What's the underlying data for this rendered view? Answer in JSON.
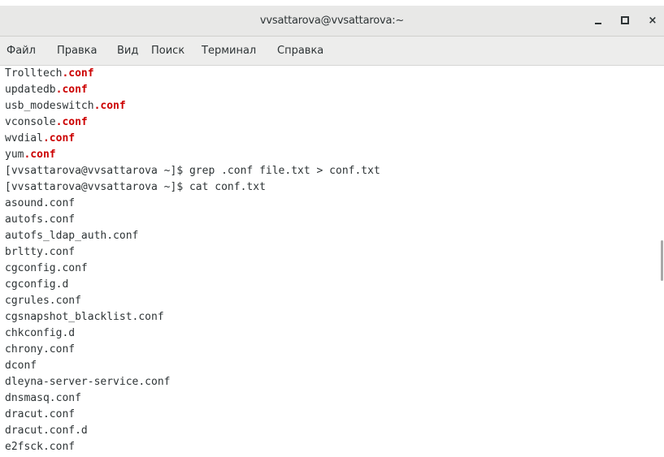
{
  "window": {
    "title": "vvsattarova@vvsattarova:~",
    "minimize_icon": "minimize-icon",
    "maximize_icon": "maximize-icon",
    "close_icon": "close-icon",
    "close_glyph": "×"
  },
  "menu": {
    "items": [
      "Файл",
      "Правка",
      "Вид",
      "Поиск",
      "Терминал",
      "Справка"
    ]
  },
  "terminal": {
    "lines": [
      {
        "pre": "Trolltech",
        "hl": ".conf"
      },
      {
        "pre": "updatedb",
        "hl": ".conf"
      },
      {
        "pre": "usb_modeswitch",
        "hl": ".conf"
      },
      {
        "pre": "vconsole",
        "hl": ".conf"
      },
      {
        "pre": "wvdial",
        "hl": ".conf"
      },
      {
        "pre": "yum",
        "hl": ".conf"
      },
      {
        "pre": "[vvsattarova@vvsattarova ~]$ grep .conf file.txt > conf.txt",
        "hl": ""
      },
      {
        "pre": "[vvsattarova@vvsattarova ~]$ cat conf.txt",
        "hl": ""
      },
      {
        "pre": "asound.conf",
        "hl": ""
      },
      {
        "pre": "autofs.conf",
        "hl": ""
      },
      {
        "pre": "autofs_ldap_auth.conf",
        "hl": ""
      },
      {
        "pre": "brltty.conf",
        "hl": ""
      },
      {
        "pre": "cgconfig.conf",
        "hl": ""
      },
      {
        "pre": "cgconfig.d",
        "hl": ""
      },
      {
        "pre": "cgrules.conf",
        "hl": ""
      },
      {
        "pre": "cgsnapshot_blacklist.conf",
        "hl": ""
      },
      {
        "pre": "chkconfig.d",
        "hl": ""
      },
      {
        "pre": "chrony.conf",
        "hl": ""
      },
      {
        "pre": "dconf",
        "hl": ""
      },
      {
        "pre": "dleyna-server-service.conf",
        "hl": ""
      },
      {
        "pre": "dnsmasq.conf",
        "hl": ""
      },
      {
        "pre": "dracut.conf",
        "hl": ""
      },
      {
        "pre": "dracut.conf.d",
        "hl": ""
      },
      {
        "pre": "e2fsck.conf",
        "hl": ""
      }
    ],
    "highlight_color": "#cc0000",
    "text_color": "#2e3436"
  }
}
